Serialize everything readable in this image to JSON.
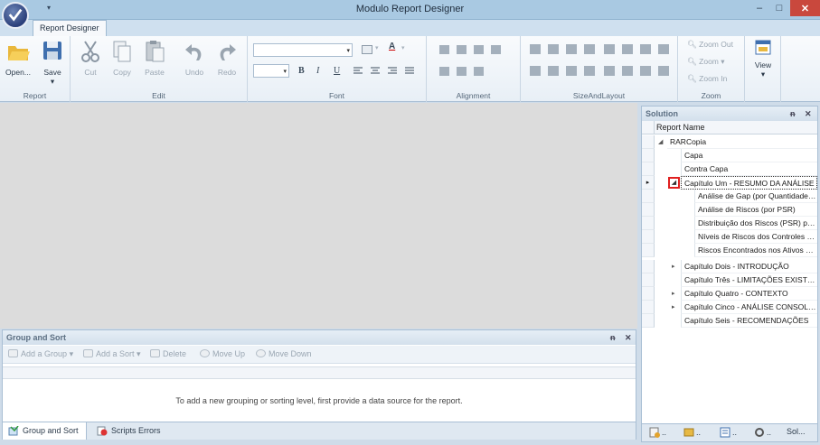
{
  "window": {
    "title": "Modulo Report Designer",
    "minimize": "–",
    "maximize": "□",
    "close": "✕",
    "qat": "▾"
  },
  "ribbon": {
    "tab": "Report Designer",
    "groups": {
      "report": {
        "caption": "Report",
        "open": "Open...",
        "save": "Save",
        "save_dd": "▾"
      },
      "edit": {
        "caption": "Edit",
        "cut": "Cut",
        "copy": "Copy",
        "paste": "Paste",
        "undo": "Undo",
        "redo": "Redo"
      },
      "font": {
        "caption": "Font",
        "combo_dd": "▾",
        "bold": "B",
        "italic": "I",
        "underline": "U",
        "fontcolor": "A",
        "fontcolor_dd": "▾"
      },
      "alignment": {
        "caption": "Alignment"
      },
      "size_layout": {
        "caption": "SizeAndLayout"
      },
      "zoom": {
        "caption": "Zoom",
        "zoom_out": "Zoom Out",
        "zoom": "Zoom",
        "zoom_dd": "▾",
        "zoom_in": "Zoom In"
      },
      "view": {
        "label": "View",
        "dd": "▾"
      }
    }
  },
  "group_sort": {
    "title": "Group and Sort",
    "pin": "ᵰ",
    "close": "✕",
    "toolbar": {
      "add_group": "Add a Group",
      "add_sort": "Add a Sort",
      "delete": "Delete",
      "move_up": "Move Up",
      "move_down": "Move Down",
      "dd": "▾"
    },
    "message": "To add a new grouping or sorting level, first provide a data source for the report.",
    "tabs": {
      "group_sort": "Group and Sort",
      "scripts_errors": "Scripts Errors"
    }
  },
  "solution": {
    "title": "Solution",
    "pin": "ᵰ",
    "close": "✕",
    "column_header": "Report Name",
    "rows": [
      {
        "label": "RARCopia",
        "expander": "◢"
      },
      {
        "label": "Capa"
      },
      {
        "label": "Contra Capa"
      },
      {
        "label": "Capítulo Um - RESUMO DA ANÁLISE",
        "expander": "◢",
        "current": "▸"
      },
      {
        "label": "Análise de Gap (por Quantidade de Controles)"
      },
      {
        "label": "Análise de Riscos (por PSR)"
      },
      {
        "label": "Distribuição dos Riscos (PSR) por Ativo"
      },
      {
        "label": "Níveis de Riscos dos Controles por Ativo"
      },
      {
        "label": "Riscos Encontrados nos Ativos por Controle"
      },
      {
        "label": "Capítulo Dois - INTRODUÇÃO",
        "expander": "▸"
      },
      {
        "label": "Capítulo Três - LIMITAÇÕES EXISTENTES"
      },
      {
        "label": "Capítulo Quatro - CONTEXTO",
        "expander": "▸"
      },
      {
        "label": "Capítulo Cinco - ANÁLISE CONSOLIDADA",
        "expander": "▸"
      },
      {
        "label": "Capítulo Seis - RECOMENDAÇÕES"
      }
    ],
    "tabs": {
      "t1": "..",
      "t2": "..",
      "t3": "..",
      "t4": "..",
      "t5": "Sol..."
    }
  }
}
